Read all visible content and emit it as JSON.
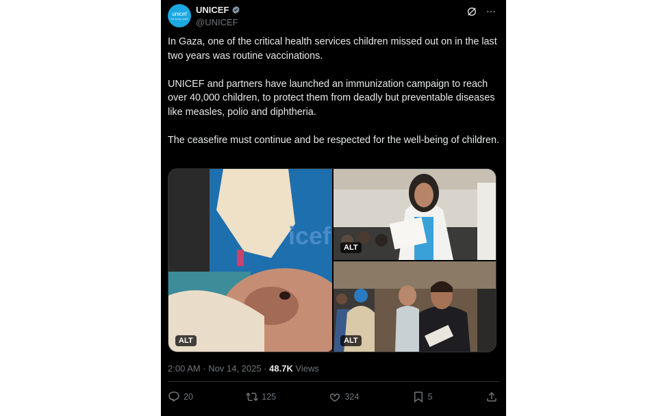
{
  "author": {
    "avatar_text": "unicef",
    "avatar_subtext": "for every child",
    "display_name": "UNICEF",
    "handle": "@UNICEF"
  },
  "tweet": {
    "paragraphs": [
      "In Gaza, one of the critical health services children missed out on in the last two years was routine vaccinations.",
      "UNICEF and partners have launched an immunization campaign to reach over 40,000 children, to protect them from deadly but preventable diseases like measles, polio and diphtheria.",
      "The ceasefire must continue and be respected for the well-being of children."
    ]
  },
  "media": {
    "alt_badge": "ALT"
  },
  "meta": {
    "timestamp": "2:00 AM · Nov 14, 2025 · ",
    "views_count": "48.7K",
    "views_label": " Views"
  },
  "actions": {
    "replies": "20",
    "reposts": "125",
    "likes": "324",
    "bookmarks": "5"
  },
  "colors": {
    "background": "#000000",
    "text": "#e7e9ea",
    "muted": "#71767b",
    "accent": "#1d9bf0"
  }
}
